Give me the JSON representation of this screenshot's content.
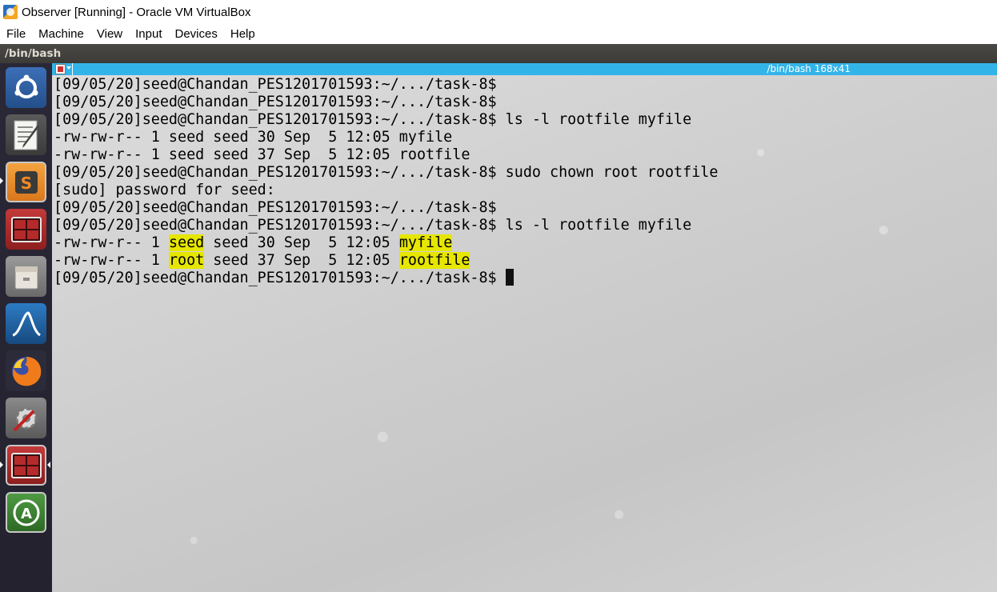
{
  "window": {
    "title": "Observer [Running] - Oracle VM VirtualBox"
  },
  "menubar": {
    "items": [
      "File",
      "Machine",
      "View",
      "Input",
      "Devices",
      "Help"
    ]
  },
  "guest_panel": {
    "title": "/bin/bash"
  },
  "terminal_titlebar": {
    "label": "/bin/bash 168x41"
  },
  "launcher": {
    "items": [
      {
        "name": "ubuntu-dash-icon",
        "color": "#2f5fa6"
      },
      {
        "name": "text-editor-icon",
        "color": "#3a3a3a"
      },
      {
        "name": "sublime-text-icon",
        "color": "#f08a24"
      },
      {
        "name": "terminal-icon",
        "color": "#b52a2a"
      },
      {
        "name": "file-manager-icon",
        "color": "#7a7a7a"
      },
      {
        "name": "wireshark-icon",
        "color": "#1c5a96"
      },
      {
        "name": "firefox-icon",
        "color": "#e66000"
      },
      {
        "name": "system-settings-icon",
        "color": "#666666"
      },
      {
        "name": "terminal-icon",
        "color": "#b52a2a"
      },
      {
        "name": "software-updater-icon",
        "color": "#3c7a32"
      }
    ]
  },
  "terminal": {
    "lines": [
      "[09/05/20]seed@Chandan_PES1201701593:~/.../task-8$",
      "[09/05/20]seed@Chandan_PES1201701593:~/.../task-8$",
      "[09/05/20]seed@Chandan_PES1201701593:~/.../task-8$ ls -l rootfile myfile",
      "-rw-rw-r-- 1 seed seed 30 Sep  5 12:05 myfile",
      "-rw-rw-r-- 1 seed seed 37 Sep  5 12:05 rootfile",
      "[09/05/20]seed@Chandan_PES1201701593:~/.../task-8$ sudo chown root rootfile",
      "[sudo] password for seed:",
      "[09/05/20]seed@Chandan_PES1201701593:~/.../task-8$",
      "[09/05/20]seed@Chandan_PES1201701593:~/.../task-8$ ls -l rootfile myfile"
    ],
    "highlighted_lines": [
      {
        "prefix": "-rw-rw-r-- 1 ",
        "owner": "seed",
        "middle": " seed 30 Sep  5 12:05 ",
        "file": "myfile"
      },
      {
        "prefix": "-rw-rw-r-- 1 ",
        "owner": "root",
        "middle": " seed 37 Sep  5 12:05 ",
        "file": "rootfile"
      }
    ],
    "prompt": "[09/05/20]seed@Chandan_PES1201701593:~/.../task-8$ ",
    "highlight_color": "#e6e600"
  }
}
